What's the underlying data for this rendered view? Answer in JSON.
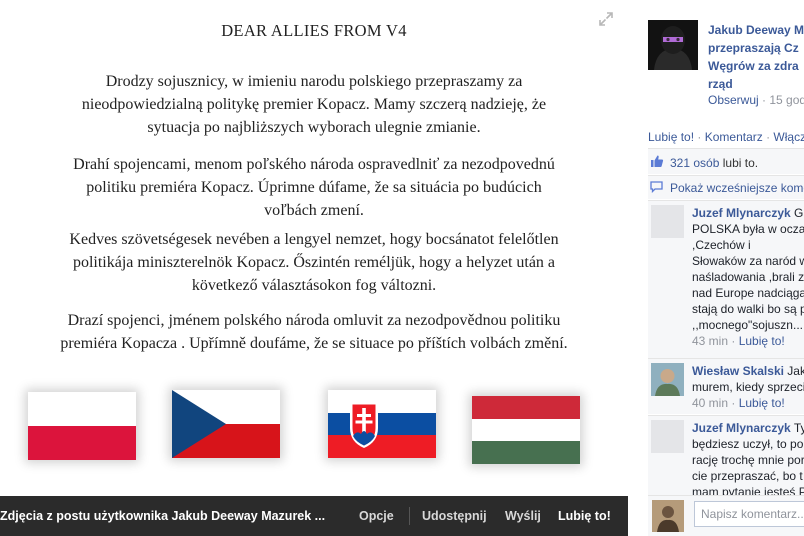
{
  "photo": {
    "letter": {
      "title": "DEAR ALLIES FROM V4",
      "pl": [
        "Drodzy sojusznicy, w imieniu narodu polskiego przepraszamy za",
        "nieodpowiedzialną politykę premier Kopacz. Mamy szczerą nadzieję, że",
        "sytuacja po najbliższych wyborach ulegnie zmianie."
      ],
      "sk": [
        "Drahí spojencami, menom poľského národa ospravedlniť za nezodpovednú",
        "politiku premiéra Kopacz. Úprimne dúfame, že sa situácia po budúcich",
        "voľbách zmení."
      ],
      "hu": [
        "Kedves szövetségesek nevében a lengyel nemzet, hogy bocsánatot felelőtlen",
        "politikája miniszterelnök Kopacz. Őszintén reméljük, hogy a helyzet után a",
        "következő választásokon fog változni."
      ],
      "cz": [
        "Drazí spojenci, jménem polského národa omluvit za nezodpovědnou politiku",
        "premiéra Kopacza . Upřímně doufáme, že se situace po příštích volbách změní."
      ]
    },
    "flags": [
      {
        "country": "Poland",
        "colors": [
          "#ffffff",
          "#dc143c"
        ]
      },
      {
        "country": "Czech Republic",
        "colors": [
          "#ffffff",
          "#d7141a",
          "#11457e"
        ]
      },
      {
        "country": "Slovakia",
        "colors": [
          "#ffffff",
          "#0b4ea2",
          "#ee1c25"
        ]
      },
      {
        "country": "Hungary",
        "colors": [
          "#ce2939",
          "#ffffff",
          "#477050"
        ]
      }
    ],
    "bar": {
      "caption": "Zdjęcia z postu użytkownika Jakub Deeway Mazurek ...",
      "options": "Opcje",
      "share": "Udostępnij",
      "send": "Wyślij",
      "like": "Lubię to!"
    },
    "expand_icon": "expand-icon"
  },
  "side": {
    "title_lines": [
      "Jakub Deeway M",
      "przepraszają Cz",
      "Węgrów za zdra",
      "rząd"
    ],
    "follow": "Obserwuj",
    "meta_sep": " · ",
    "time": "15 godz",
    "actions": {
      "like": "Lubię to!",
      "comment": "Komentarz",
      "share": "Włącz",
      "sep": " · "
    },
    "likes": {
      "count": "321 osób",
      "suffix": " lubi to."
    },
    "show_previous": "Pokaż wcześniejsze kome",
    "comments": [
      {
        "name": "Juzef Mlynarczyk",
        "first_line_tail": " Gr",
        "lines": [
          "POLSKA była w oczac",
          ",Czechów i",
          "Słowaków za naród w",
          "naśladowania ,brali z",
          "nad Europe nadciąga",
          "stają do walki bo są p",
          ",,mocnego\"sojuszn..."
        ],
        "time": "43 min",
        "like": "Lubię to!"
      },
      {
        "name": "Wiesław Skalski",
        "first_line_tail": " Jak",
        "lines": [
          "murem, kiedy sprzeci"
        ],
        "time": "40 min",
        "like": "Lubię to!"
      },
      {
        "name": "Juzef Mlynarczyk",
        "first_line_tail": " Ty",
        "lines": [
          "będziesz uczył, to po",
          "rację trochę mnie por",
          "cie przepraszać, bo t",
          "mam pytanie jesteś P"
        ],
        "time": "",
        "like": ""
      }
    ],
    "write_placeholder": "Napisz komentarz..."
  },
  "colors": {
    "link": "#3b5998",
    "muted": "#90949c",
    "bar_bg": "#2b2b2b",
    "panel_bg": "#f6f7f9"
  }
}
